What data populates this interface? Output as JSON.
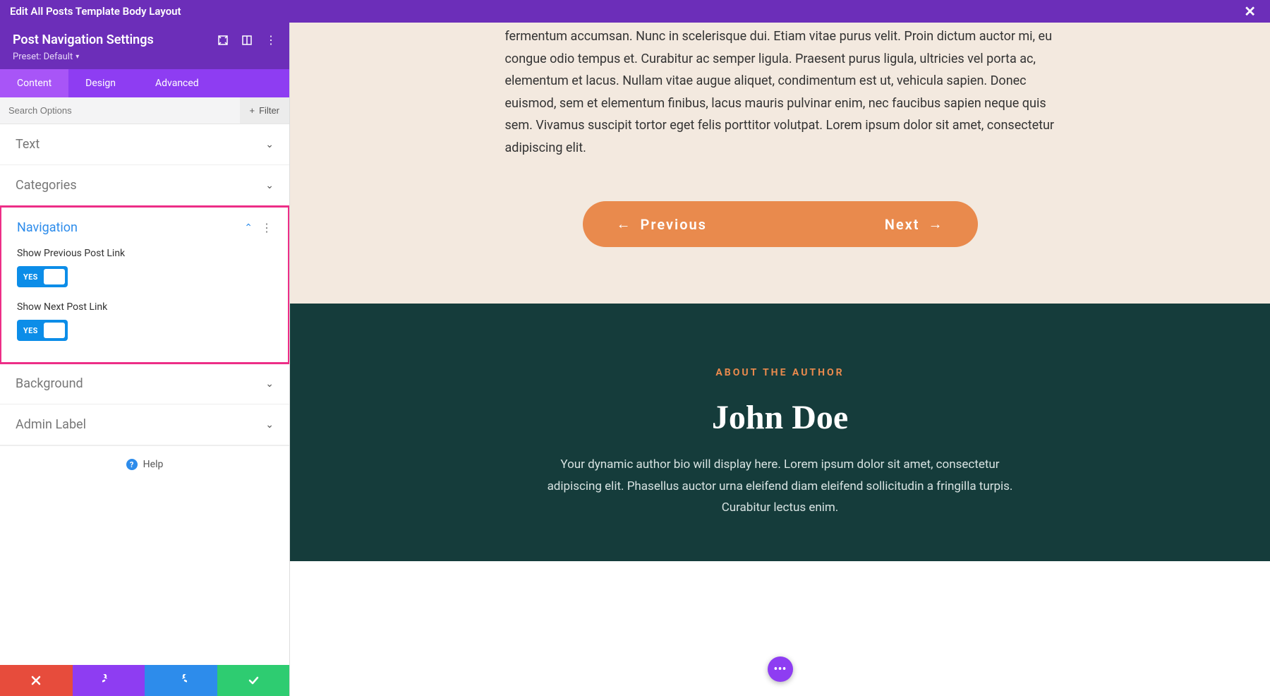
{
  "topbar": {
    "title": "Edit All Posts Template Body Layout"
  },
  "panel": {
    "title": "Post Navigation Settings",
    "preset_label": "Preset: Default"
  },
  "tabs": [
    "Content",
    "Design",
    "Advanced"
  ],
  "search": {
    "placeholder": "Search Options",
    "filter_label": "Filter"
  },
  "sections": {
    "text": "Text",
    "categories": "Categories",
    "navigation": "Navigation",
    "background": "Background",
    "admin_label": "Admin Label"
  },
  "nav_fields": {
    "show_prev_label": "Show Previous Post Link",
    "show_next_label": "Show Next Post Link",
    "toggle_on": "YES"
  },
  "help_label": "Help",
  "preview": {
    "body": "fermentum accumsan. Nunc in scelerisque dui. Etiam vitae purus velit. Proin dictum auctor mi, eu congue odio tempus et. Curabitur ac semper ligula. Praesent purus ligula, ultricies vel porta ac, elementum et lacus. Nullam vitae augue aliquet, condimentum est ut, vehicula sapien. Donec euismod, sem et elementum finibus, lacus mauris pulvinar enim, nec faucibus sapien neque quis sem. Vivamus suscipit tortor eget felis porttitor volutpat. Lorem ipsum dolor sit amet, consectetur adipiscing elit.",
    "prev_label": "Previous",
    "next_label": "Next",
    "about_label": "ABOUT THE AUTHOR",
    "author_name": "John Doe",
    "author_bio": "Your dynamic author bio will display here. Lorem ipsum dolor sit amet, consectetur adipiscing elit. Phasellus auctor urna eleifend diam eleifend sollicitudin a fringilla turpis. Curabitur lectus enim."
  }
}
